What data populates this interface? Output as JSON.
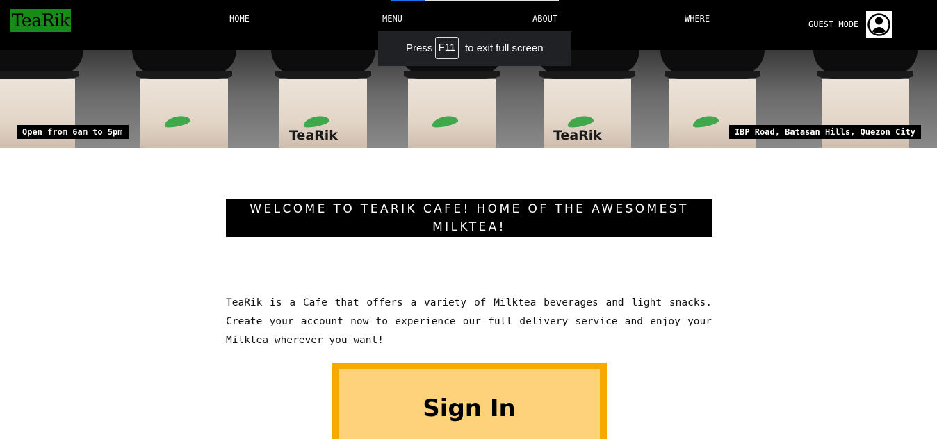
{
  "header": {
    "logo": "TeaRik",
    "nav": [
      {
        "label": "HOME"
      },
      {
        "label": "MENU"
      },
      {
        "label": "ABOUT"
      },
      {
        "label": "WHERE"
      }
    ],
    "guest_label": "GUEST MODE",
    "avatar_icon": "user-avatar-icon"
  },
  "fullscreen_toast": {
    "press": "Press",
    "key": "F11",
    "rest": "to exit full screen"
  },
  "hero": {
    "cup_brand": "TeaRik",
    "hours": "Open from 6am to 5pm",
    "address": "IBP Road, Batasan Hills, Quezon City"
  },
  "welcome": {
    "line1": "WELCOME TO TEARIK CAFE! HOME OF THE AWESOMEST",
    "line2": "MILKTEA!"
  },
  "intro": "TeaRik is a Cafe that offers a variety of Milktea beverages and light snacks. Create your account now to experience our full delivery service and enjoy your Milktea wherever you want!",
  "signin": {
    "label": "Sign In"
  },
  "colors": {
    "logo_bg": "#178a17",
    "signin_border": "#f8a800",
    "signin_fill": "#fdd27a"
  }
}
